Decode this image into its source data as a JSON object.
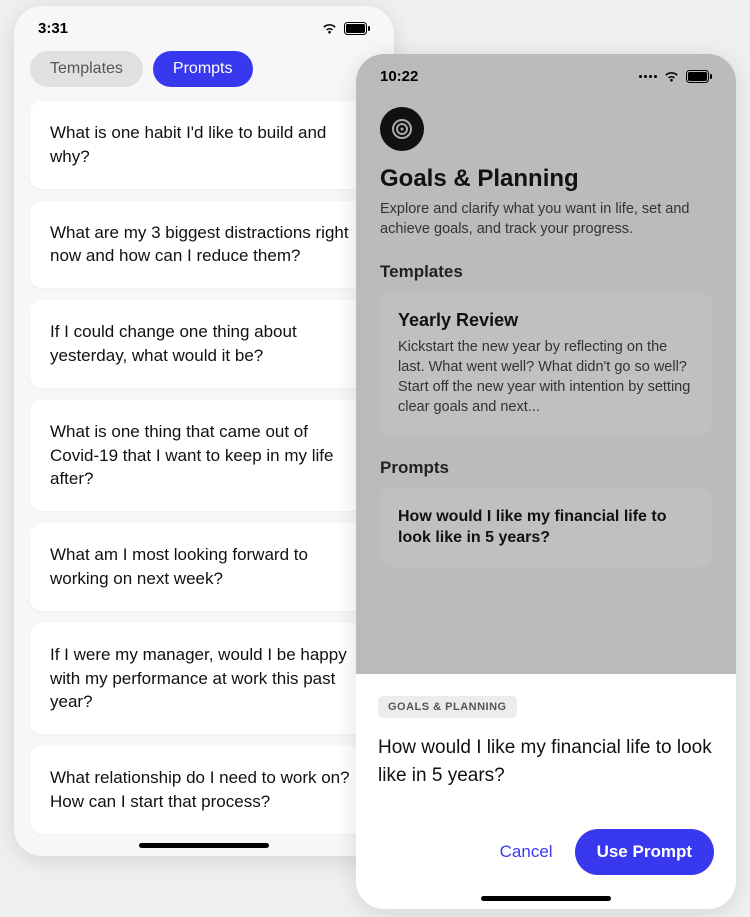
{
  "left": {
    "time": "3:31",
    "tabs": {
      "inactive": "Templates",
      "active": "Prompts"
    },
    "prompts": [
      "What is one habit I'd like to build and why?",
      "What are my 3 biggest distractions right now and how can I reduce them?",
      "If I could change one thing about yesterday, what would it be?",
      "What is one thing that came out of Covid-19 that I want to keep in my life after?",
      "What am I most looking forward to working on next week?",
      "If I were my manager, would I be happy with my performance at work this past year?",
      "What relationship do I need to work on? How can I start that process?"
    ]
  },
  "right": {
    "time": "10:22",
    "category": {
      "title": "Goals & Planning",
      "description": "Explore and clarify what you want in life, set and achieve goals, and track your progress."
    },
    "sections": {
      "templates_label": "Templates",
      "prompts_label": "Prompts"
    },
    "template": {
      "title": "Yearly Review",
      "description": "Kickstart the new year by reflecting on the last. What went well? What didn't go so well? Start off the new year with intention by setting clear goals and next..."
    },
    "prompt_preview": "How would I like my financial life to look like in 5 years?",
    "sheet": {
      "chip": "GOALS & PLANNING",
      "question": "How would I like my financial life to look like in 5 years?",
      "cancel": "Cancel",
      "use": "Use Prompt"
    }
  }
}
